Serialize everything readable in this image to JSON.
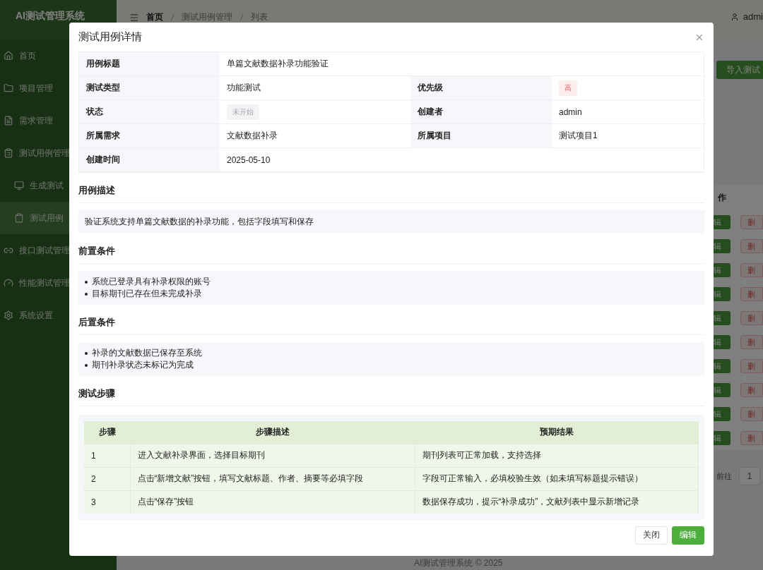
{
  "app": {
    "brand": "AI测试管理系统",
    "sidebar": {
      "items": [
        {
          "label": "首页",
          "selected": false
        },
        {
          "label": "项目管理",
          "selected": false
        },
        {
          "label": "需求管理",
          "selected": false
        },
        {
          "label": "测试用例管理",
          "selected": false,
          "children": [
            {
              "label": "生成测试",
              "selected": false
            },
            {
              "label": "测试用例",
              "selected": true
            }
          ]
        },
        {
          "label": "接口测试管理",
          "selected": false
        },
        {
          "label": "性能测试管理",
          "selected": false
        },
        {
          "label": "系统设置",
          "selected": false
        }
      ]
    },
    "header": {
      "breadcrumb": [
        "首页",
        "测试用例管理",
        "列表"
      ],
      "user": "admi"
    },
    "toolbar": {
      "import_button": "导入测试"
    },
    "table": {
      "column": "作",
      "rows": [
        {
          "edit": "辑",
          "delete": "删"
        },
        {
          "edit": "辑",
          "delete": "删"
        },
        {
          "edit": "辑",
          "delete": "删"
        },
        {
          "edit": "辑",
          "delete": "删"
        },
        {
          "edit": "辑",
          "delete": "删"
        },
        {
          "edit": "辑",
          "delete": "删"
        },
        {
          "edit": "辑",
          "delete": "删"
        },
        {
          "edit": "辑",
          "delete": "删"
        },
        {
          "edit": "辑",
          "delete": "删"
        },
        {
          "edit": "辑",
          "delete": "删"
        }
      ]
    },
    "pagination": {
      "goto_label": "前往",
      "page": "1"
    },
    "footer": "AI测试管理系统 © 2025"
  },
  "dialog": {
    "title": "测试用例详情",
    "details": [
      [
        {
          "label": "用例标题",
          "value": "单篇文献数据补录功能验证",
          "kind": "text"
        }
      ],
      [
        {
          "label": "测试类型",
          "value": "功能测试",
          "kind": "text"
        },
        {
          "label": "优先级",
          "value": "高",
          "kind": "danger"
        }
      ],
      [
        {
          "label": "状态",
          "value": "未开始",
          "kind": "info"
        },
        {
          "label": "创建者",
          "value": "admin",
          "kind": "text"
        }
      ],
      [
        {
          "label": "所属需求",
          "value": "文献数据补录",
          "kind": "text"
        },
        {
          "label": "所属项目",
          "value": "测试项目1",
          "kind": "text"
        }
      ],
      [
        {
          "label": "创建时间",
          "value": "2025-05-10",
          "kind": "text"
        }
      ]
    ],
    "description": {
      "heading": "用例描述",
      "text": "验证系统支持单篇文献数据的补录功能，包括字段填写和保存"
    },
    "preconditions": {
      "heading": "前置条件",
      "items": [
        "系统已登录具有补录权限的账号",
        "目标期刊已存在但未完成补录"
      ]
    },
    "postconditions": {
      "heading": "后置条件",
      "items": [
        "补录的文献数据已保存至系统",
        "期刊补录状态未标记为完成"
      ]
    },
    "steps": {
      "heading": "测试步骤",
      "columns": [
        "步骤",
        "步骤描述",
        "预期结果"
      ],
      "rows": [
        [
          "1",
          "进入文献补录界面，选择目标期刊",
          "期刊列表可正常加载，支持选择"
        ],
        [
          "2",
          "点击“新增文献”按钮，填写文献标题、作者、摘要等必填字段",
          "字段可正常输入，必填校验生效（如未填写标题提示错误）"
        ],
        [
          "3",
          "点击“保存”按钮",
          "数据保存成功，提示“补录成功”，文献列表中显示新增记录"
        ]
      ]
    },
    "buttons": [
      {
        "label": "关闭",
        "kind": "default"
      },
      {
        "label": "编辑",
        "kind": "primary"
      }
    ]
  }
}
